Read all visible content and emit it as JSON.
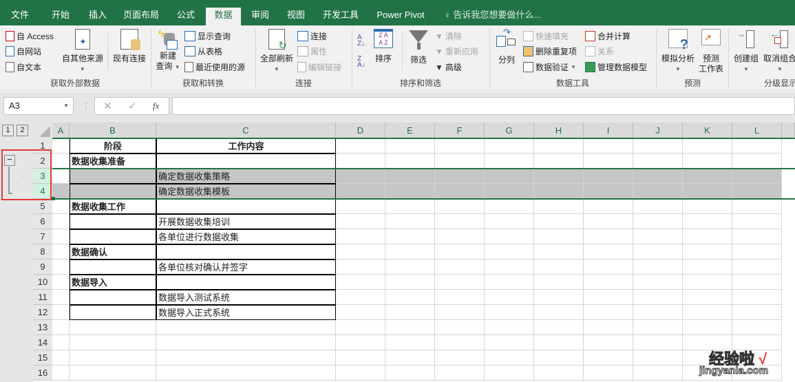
{
  "tabs": [
    "文件",
    "开始",
    "插入",
    "页面布局",
    "公式",
    "数据",
    "审阅",
    "视图",
    "开发工具",
    "Power Pivot"
  ],
  "active_tab": "数据",
  "tell_me": "告诉我您想要做什么...",
  "ribbon": {
    "groups": [
      "获取外部数据",
      "获取和转换",
      "连接",
      "排序和筛选",
      "数据工具",
      "预测",
      "分级显示"
    ],
    "get_external": {
      "access": "自 Access",
      "web": "自网站",
      "text": "自文本",
      "other": "自其他来源",
      "existing": "现有连接"
    },
    "get_transform": {
      "new_query_1": "新建",
      "new_query_2": "查询",
      "show_queries": "显示查询",
      "from_table": "从表格",
      "recent_sources": "最近使用的源"
    },
    "connections": {
      "refresh_all": "全部刷新",
      "connections": "连接",
      "properties": "属性",
      "edit_links": "编辑链接"
    },
    "sort_filter": {
      "sort": "排序",
      "filter": "筛选",
      "clear": "清除",
      "reapply": "重新应用",
      "advanced": "高级"
    },
    "data_tools": {
      "text_to_columns": "分列",
      "flash_fill": "快速填充",
      "remove_dup": "删除重复项",
      "validation": "数据验证",
      "consolidate": "合并计算",
      "relationships": "关系",
      "manage_model": "管理数据模型"
    },
    "forecast": {
      "what_if": "模拟分析",
      "sheet_1": "预测",
      "sheet_2": "工作表"
    },
    "outline": {
      "group": "创建组",
      "ungroup": "取消组合"
    }
  },
  "formula_bar": {
    "name_box": "A3",
    "formula": "",
    "fx": "fx"
  },
  "outline_levels": [
    "1",
    "2"
  ],
  "columns": [
    "A",
    "B",
    "C",
    "D",
    "E",
    "F",
    "G",
    "H",
    "I",
    "J",
    "K",
    "L"
  ],
  "rows": [
    {
      "n": "1",
      "b": "阶段",
      "c": "工作内容"
    },
    {
      "n": "2",
      "b": "数据收集准备",
      "c": ""
    },
    {
      "n": "3",
      "b": "",
      "c": "确定数据收集策略"
    },
    {
      "n": "4",
      "b": "",
      "c": "确定数据收集模板"
    },
    {
      "n": "5",
      "b": "数据收集工作",
      "c": ""
    },
    {
      "n": "6",
      "b": "",
      "c": "开展数据收集培训"
    },
    {
      "n": "7",
      "b": "",
      "c": "各单位进行数据收集"
    },
    {
      "n": "8",
      "b": "数据确认",
      "c": ""
    },
    {
      "n": "9",
      "b": "",
      "c": "各单位核对确认并签字"
    },
    {
      "n": "10",
      "b": "数据导入",
      "c": ""
    },
    {
      "n": "11",
      "b": "",
      "c": "数据导入测试系统"
    },
    {
      "n": "12",
      "b": "",
      "c": "数据导入正式系统"
    },
    {
      "n": "13",
      "b": "",
      "c": ""
    },
    {
      "n": "14",
      "b": "",
      "c": ""
    },
    {
      "n": "15",
      "b": "",
      "c": ""
    },
    {
      "n": "16",
      "b": "",
      "c": ""
    }
  ],
  "watermark": {
    "line1": "经验啦",
    "check": "√",
    "line2": "jingyanla.com"
  }
}
